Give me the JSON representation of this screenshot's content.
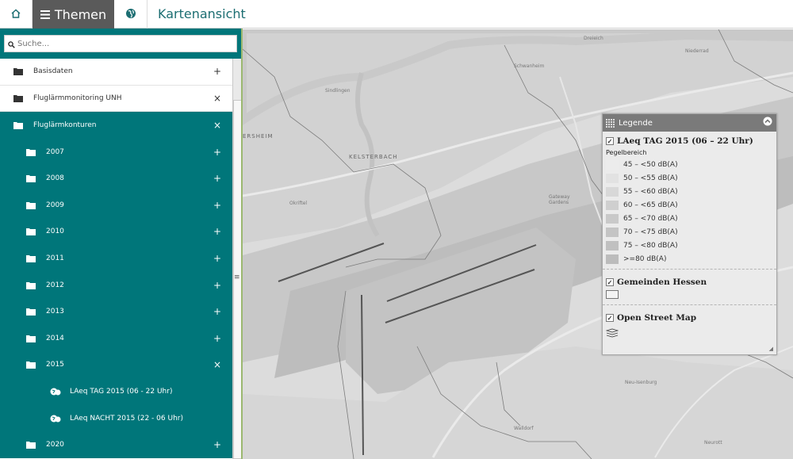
{
  "topbar": {
    "home_icon": "home-icon",
    "themen_label": "Themen",
    "globe_icon": "globe-icon",
    "title": "Kartenansicht"
  },
  "search": {
    "placeholder": "Suche..."
  },
  "tree": [
    {
      "label": "Basisdaten",
      "action": "+",
      "level": 0,
      "style": "white"
    },
    {
      "label": "Fluglärmmonitoring UNH",
      "action": "×",
      "level": 0,
      "style": "white"
    },
    {
      "label": "Fluglärmkonturen",
      "action": "×",
      "level": 1,
      "style": "teal"
    },
    {
      "label": "2007",
      "action": "+",
      "level": 2,
      "style": "teal"
    },
    {
      "label": "2008",
      "action": "+",
      "level": 2,
      "style": "teal"
    },
    {
      "label": "2009",
      "action": "+",
      "level": 2,
      "style": "teal"
    },
    {
      "label": "2010",
      "action": "+",
      "level": 2,
      "style": "teal"
    },
    {
      "label": "2011",
      "action": "+",
      "level": 2,
      "style": "teal"
    },
    {
      "label": "2012",
      "action": "+",
      "level": 2,
      "style": "teal"
    },
    {
      "label": "2013",
      "action": "+",
      "level": 2,
      "style": "teal"
    },
    {
      "label": "2014",
      "action": "+",
      "level": 2,
      "style": "teal"
    },
    {
      "label": "2015",
      "action": "×",
      "level": 2,
      "style": "teal"
    },
    {
      "label": "LAeq TAG 2015 (06 - 22 Uhr)",
      "action": "",
      "level": 3,
      "style": "teal"
    },
    {
      "label": "LAeq NACHT 2015 (22 - 06 Uhr)",
      "action": "",
      "level": 3,
      "style": "teal"
    },
    {
      "label": "2020",
      "action": "+",
      "level": 2,
      "style": "teal"
    }
  ],
  "map": {
    "places": [
      {
        "name": "Dreieich"
      },
      {
        "name": "Niederrad"
      },
      {
        "name": "Schwanheim"
      },
      {
        "name": "Sindlingen"
      },
      {
        "name": "KELSTERBACH"
      },
      {
        "name": "ERSHEIM"
      },
      {
        "name": "Okriftel"
      },
      {
        "name": "Gateway Gardens"
      },
      {
        "name": "Walldorf"
      },
      {
        "name": "Neu-Isenburg"
      },
      {
        "name": "Neurott"
      }
    ]
  },
  "legend": {
    "title": "Legende",
    "section1": {
      "title": "LAeq TAG 2015 (06 – 22 Uhr)",
      "subtitle": "Pegelbereich",
      "items": [
        {
          "label": "45 – <50 dB(A)",
          "color": "#ececec"
        },
        {
          "label": "50 – <55 dB(A)",
          "color": "#e2e2e2"
        },
        {
          "label": "55 – <60 dB(A)",
          "color": "#d8d8d8"
        },
        {
          "label": "60 – <65 dB(A)",
          "color": "#cfcfcf"
        },
        {
          "label": "65 – <70 dB(A)",
          "color": "#c9c9c9"
        },
        {
          "label": "70 – <75 dB(A)",
          "color": "#c4c4c4"
        },
        {
          "label": "75 – <80 dB(A)",
          "color": "#c0c0c0"
        },
        {
          "label": ">=80 dB(A)",
          "color": "#bcbcbc"
        }
      ]
    },
    "section2": {
      "title": "Gemeinden Hessen"
    },
    "section3": {
      "title": "Open Street Map"
    }
  },
  "colors": {
    "teal": "#00767a",
    "topbar_active": "#5a5a5a",
    "title": "#1c6e72"
  }
}
